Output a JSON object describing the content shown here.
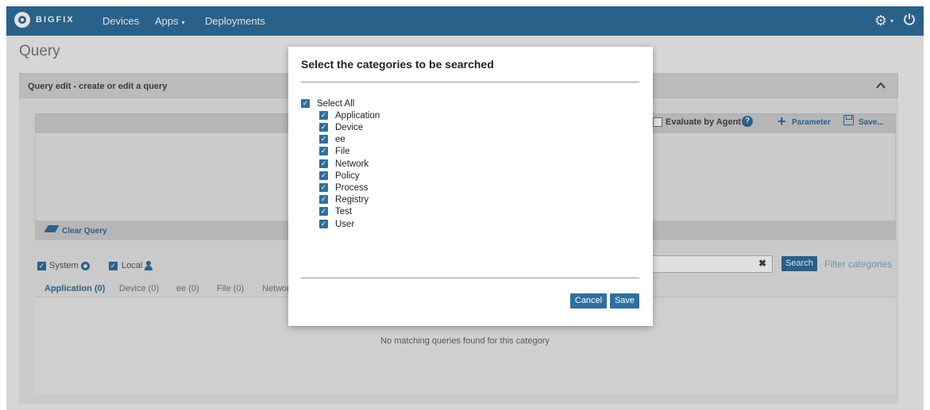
{
  "topnav": {
    "brand": "BIGFIX",
    "links": {
      "devices": "Devices",
      "apps": "Apps",
      "deployments": "Deployments"
    },
    "apps_caret": "▾",
    "settings_icon": "gear-icon",
    "settings_caret": "▾",
    "power_icon": "power-icon"
  },
  "page": {
    "title": "Query"
  },
  "panel": {
    "header": "Query edit - create or edit a query",
    "evaluate_by_agent": {
      "label": "Evaluate by Agent",
      "checked": false
    },
    "parameter_label": "Parameter",
    "save_label": "Save...",
    "clear_query_label": "Clear Query"
  },
  "sources": {
    "system": {
      "label": "System",
      "checked": true
    },
    "local": {
      "label": "Local",
      "checked": true
    }
  },
  "tabs": [
    {
      "label": "Application (0)",
      "active": true
    },
    {
      "label": "Device (0)",
      "active": false
    },
    {
      "label": "ee (0)",
      "active": false
    },
    {
      "label": "File (0)",
      "active": false
    },
    {
      "label": "Networ",
      "active": false
    }
  ],
  "results": {
    "empty_message": "No matching queries found for this category"
  },
  "search": {
    "value": "",
    "clear_glyph": "✖",
    "button": "Search",
    "filter_link": "Filter categories"
  },
  "modal": {
    "title": "Select the categories to be searched",
    "select_all": {
      "label": "Select All",
      "checked": true
    },
    "categories": [
      {
        "label": "Application",
        "checked": true
      },
      {
        "label": "Device",
        "checked": true
      },
      {
        "label": "ee",
        "checked": true
      },
      {
        "label": "File",
        "checked": true
      },
      {
        "label": "Network",
        "checked": true
      },
      {
        "label": "Policy",
        "checked": true
      },
      {
        "label": "Process",
        "checked": true
      },
      {
        "label": "Registry",
        "checked": true
      },
      {
        "label": "Test",
        "checked": true
      },
      {
        "label": "User",
        "checked": true
      }
    ],
    "cancel_button": "Cancel",
    "save_button": "Save"
  },
  "colors": {
    "nav": "#2f6f9e",
    "accent": "#2f6f9e",
    "page_bg": "#f4f4f4"
  }
}
